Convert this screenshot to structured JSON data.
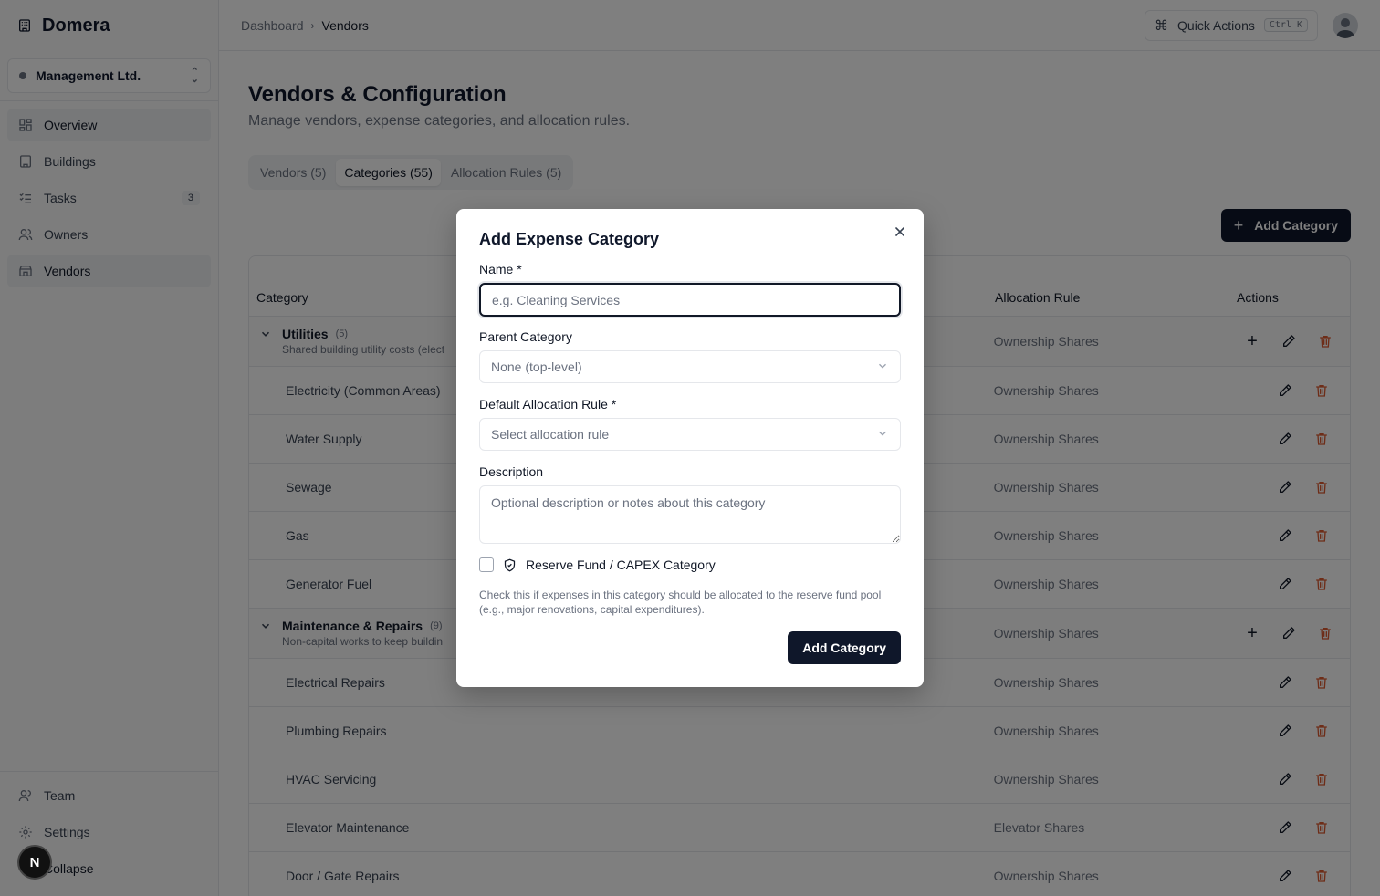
{
  "app": {
    "name": "Domera"
  },
  "org": {
    "name": "Management Ltd."
  },
  "sidebar": {
    "items": [
      {
        "label": "Overview",
        "icon": "grid-icon"
      },
      {
        "label": "Buildings",
        "icon": "building-icon"
      },
      {
        "label": "Tasks",
        "icon": "list-checks-icon",
        "badge": "3"
      },
      {
        "label": "Owners",
        "icon": "users-icon"
      },
      {
        "label": "Vendors",
        "icon": "store-icon"
      }
    ],
    "bottom": [
      {
        "label": "Team",
        "icon": "users-icon"
      },
      {
        "label": "Settings",
        "icon": "gear-icon"
      },
      {
        "label": "Collapse",
        "icon": "collapse-icon"
      }
    ],
    "dev_badge": "N"
  },
  "header": {
    "breadcrumb": [
      "Dashboard",
      "Vendors"
    ],
    "quick_actions": "Quick Actions",
    "shortcut": "Ctrl K"
  },
  "page": {
    "title": "Vendors & Configuration",
    "subtitle": "Manage vendors, expense categories, and allocation rules.",
    "tabs": [
      "Vendors (5)",
      "Categories (55)",
      "Allocation Rules (5)"
    ],
    "active_tab": 1,
    "add_button": "Add Category"
  },
  "table": {
    "columns": [
      "Category",
      "Allocation Rule",
      "Actions"
    ],
    "rows": [
      {
        "type": "parent",
        "name": "Utilities",
        "count": "(5)",
        "description": "Shared building utility costs (elect",
        "rule": "Ownership Shares"
      },
      {
        "type": "child",
        "name": "Electricity (Common Areas)",
        "rule": "Ownership Shares"
      },
      {
        "type": "child",
        "name": "Water Supply",
        "rule": "Ownership Shares"
      },
      {
        "type": "child",
        "name": "Sewage",
        "rule": "Ownership Shares"
      },
      {
        "type": "child",
        "name": "Gas",
        "rule": "Ownership Shares"
      },
      {
        "type": "child",
        "name": "Generator Fuel",
        "rule": "Ownership Shares"
      },
      {
        "type": "parent",
        "name": "Maintenance & Repairs",
        "count": "(9)",
        "description": "Non-capital works to keep buildin",
        "rule": "Ownership Shares"
      },
      {
        "type": "child",
        "name": "Electrical Repairs",
        "rule": "Ownership Shares"
      },
      {
        "type": "child",
        "name": "Plumbing Repairs",
        "rule": "Ownership Shares"
      },
      {
        "type": "child",
        "name": "HVAC Servicing",
        "rule": "Ownership Shares"
      },
      {
        "type": "child",
        "name": "Elevator Maintenance",
        "rule": "Elevator Shares"
      },
      {
        "type": "child",
        "name": "Door / Gate Repairs",
        "rule": "Ownership Shares"
      }
    ]
  },
  "modal": {
    "title": "Add Expense Category",
    "name_label": "Name *",
    "name_placeholder": "e.g. Cleaning Services",
    "parent_label": "Parent Category",
    "parent_value": "None (top-level)",
    "rule_label": "Default Allocation Rule *",
    "rule_placeholder": "Select allocation rule",
    "desc_label": "Description",
    "desc_placeholder": "Optional description or notes about this category",
    "reserve_label": "Reserve Fund / CAPEX Category",
    "reserve_help": "Check this if expenses in this category should be allocated to the reserve fund pool (e.g., major renovations, capital expenditures).",
    "submit": "Add Category"
  },
  "colors": {
    "primary": "#0f172a",
    "danger": "#dc5a30",
    "overlay": "rgba(0,0,0,0.5)"
  }
}
